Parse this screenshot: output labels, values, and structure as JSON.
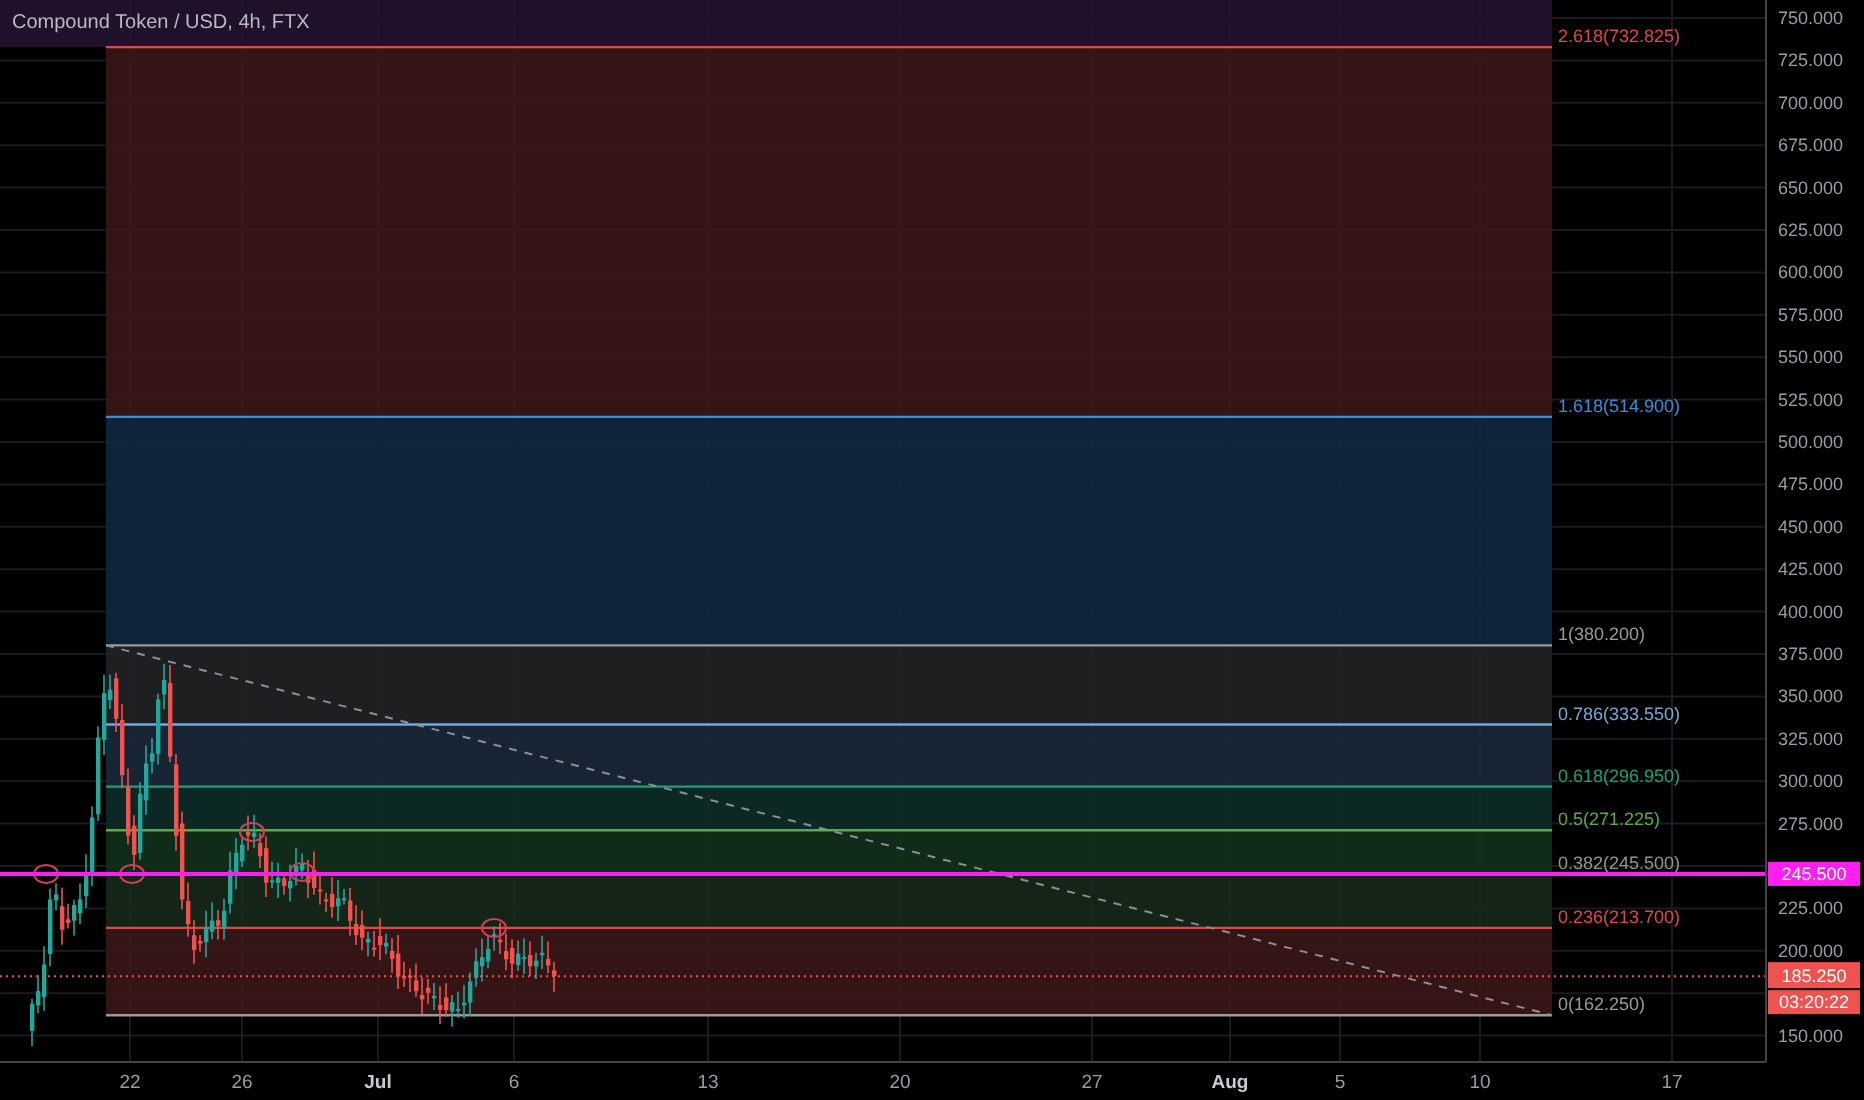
{
  "title": "Compound Token / USD, 4h, FTX",
  "price_axis": {
    "ticks": [
      "750.000",
      "725.000",
      "700.000",
      "675.000",
      "650.000",
      "625.000",
      "600.000",
      "575.000",
      "550.000",
      "525.000",
      "500.000",
      "475.000",
      "450.000",
      "425.000",
      "400.000",
      "375.000",
      "350.000",
      "325.000",
      "300.000",
      "275.000",
      "225.000",
      "200.000",
      "150.000"
    ]
  },
  "time_axis": {
    "ticks": [
      {
        "label": "22",
        "kind": "day"
      },
      {
        "label": "26",
        "kind": "day"
      },
      {
        "label": "Jul",
        "kind": "month"
      },
      {
        "label": "6",
        "kind": "day"
      },
      {
        "label": "13",
        "kind": "day"
      },
      {
        "label": "20",
        "kind": "day"
      },
      {
        "label": "27",
        "kind": "day"
      },
      {
        "label": "Aug",
        "kind": "month"
      },
      {
        "label": "5",
        "kind": "day"
      },
      {
        "label": "10",
        "kind": "day"
      },
      {
        "label": "17",
        "kind": "day"
      }
    ]
  },
  "fib_levels": [
    {
      "label": "2.618(732.825)",
      "color": "#e04848"
    },
    {
      "label": "1.618(514.900)",
      "color": "#3a8ed8"
    },
    {
      "label": "1(380.200)",
      "color": "#9a9a9a"
    },
    {
      "label": "0.786(333.550)",
      "color": "#76a9d9"
    },
    {
      "label": "0.618(296.950)",
      "color": "#1f9e78"
    },
    {
      "label": "0.5(271.225)",
      "color": "#5fa84a"
    },
    {
      "label": "0.382(245.500)",
      "color": "#8a9a8a"
    },
    {
      "label": "0.236(213.700)",
      "color": "#e04848"
    },
    {
      "label": "0(162.250)",
      "color": "#9a9a9a"
    }
  ],
  "horizontal_line": {
    "label": "245.500"
  },
  "last_price": {
    "label": "185.250",
    "countdown": "03:20:22"
  }
}
